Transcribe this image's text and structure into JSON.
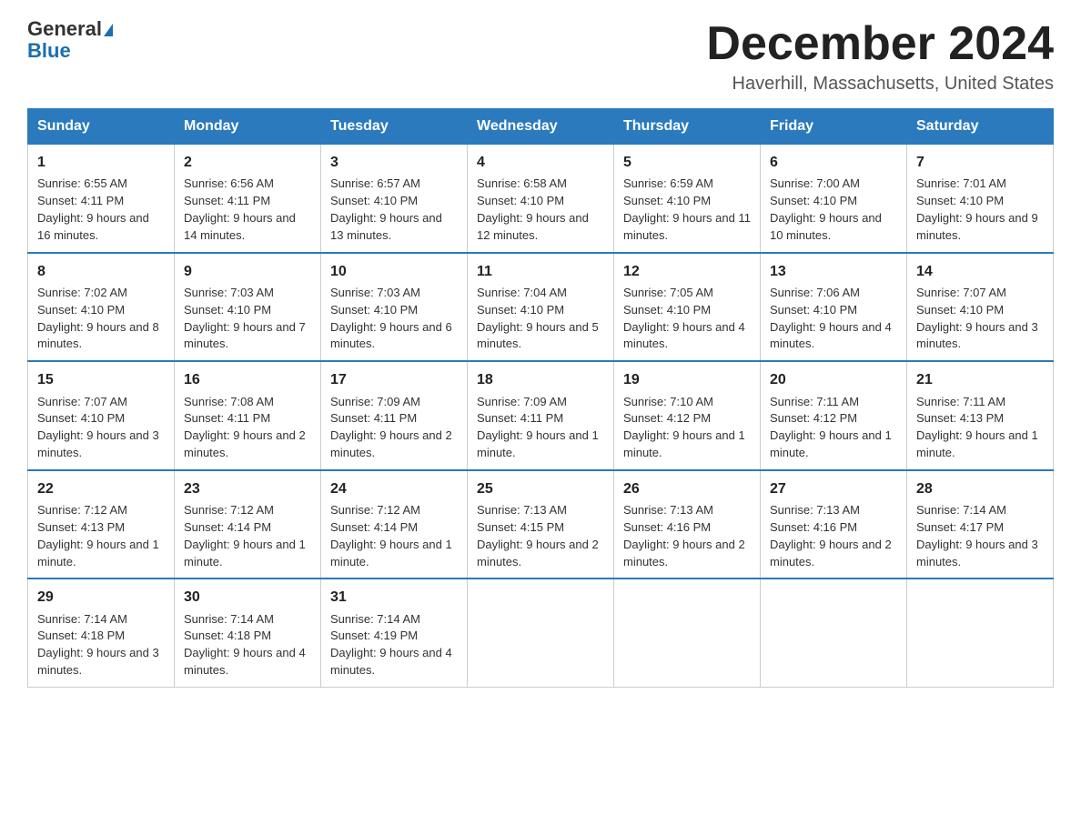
{
  "header": {
    "logo_general": "General",
    "logo_blue": "Blue",
    "month_title": "December 2024",
    "location": "Haverhill, Massachusetts, United States"
  },
  "days_of_week": [
    "Sunday",
    "Monday",
    "Tuesday",
    "Wednesday",
    "Thursday",
    "Friday",
    "Saturday"
  ],
  "weeks": [
    [
      {
        "day": "1",
        "sunrise": "6:55 AM",
        "sunset": "4:11 PM",
        "daylight": "9 hours and 16 minutes."
      },
      {
        "day": "2",
        "sunrise": "6:56 AM",
        "sunset": "4:11 PM",
        "daylight": "9 hours and 14 minutes."
      },
      {
        "day": "3",
        "sunrise": "6:57 AM",
        "sunset": "4:10 PM",
        "daylight": "9 hours and 13 minutes."
      },
      {
        "day": "4",
        "sunrise": "6:58 AM",
        "sunset": "4:10 PM",
        "daylight": "9 hours and 12 minutes."
      },
      {
        "day": "5",
        "sunrise": "6:59 AM",
        "sunset": "4:10 PM",
        "daylight": "9 hours and 11 minutes."
      },
      {
        "day": "6",
        "sunrise": "7:00 AM",
        "sunset": "4:10 PM",
        "daylight": "9 hours and 10 minutes."
      },
      {
        "day": "7",
        "sunrise": "7:01 AM",
        "sunset": "4:10 PM",
        "daylight": "9 hours and 9 minutes."
      }
    ],
    [
      {
        "day": "8",
        "sunrise": "7:02 AM",
        "sunset": "4:10 PM",
        "daylight": "9 hours and 8 minutes."
      },
      {
        "day": "9",
        "sunrise": "7:03 AM",
        "sunset": "4:10 PM",
        "daylight": "9 hours and 7 minutes."
      },
      {
        "day": "10",
        "sunrise": "7:03 AM",
        "sunset": "4:10 PM",
        "daylight": "9 hours and 6 minutes."
      },
      {
        "day": "11",
        "sunrise": "7:04 AM",
        "sunset": "4:10 PM",
        "daylight": "9 hours and 5 minutes."
      },
      {
        "day": "12",
        "sunrise": "7:05 AM",
        "sunset": "4:10 PM",
        "daylight": "9 hours and 4 minutes."
      },
      {
        "day": "13",
        "sunrise": "7:06 AM",
        "sunset": "4:10 PM",
        "daylight": "9 hours and 4 minutes."
      },
      {
        "day": "14",
        "sunrise": "7:07 AM",
        "sunset": "4:10 PM",
        "daylight": "9 hours and 3 minutes."
      }
    ],
    [
      {
        "day": "15",
        "sunrise": "7:07 AM",
        "sunset": "4:10 PM",
        "daylight": "9 hours and 3 minutes."
      },
      {
        "day": "16",
        "sunrise": "7:08 AM",
        "sunset": "4:11 PM",
        "daylight": "9 hours and 2 minutes."
      },
      {
        "day": "17",
        "sunrise": "7:09 AM",
        "sunset": "4:11 PM",
        "daylight": "9 hours and 2 minutes."
      },
      {
        "day": "18",
        "sunrise": "7:09 AM",
        "sunset": "4:11 PM",
        "daylight": "9 hours and 1 minute."
      },
      {
        "day": "19",
        "sunrise": "7:10 AM",
        "sunset": "4:12 PM",
        "daylight": "9 hours and 1 minute."
      },
      {
        "day": "20",
        "sunrise": "7:11 AM",
        "sunset": "4:12 PM",
        "daylight": "9 hours and 1 minute."
      },
      {
        "day": "21",
        "sunrise": "7:11 AM",
        "sunset": "4:13 PM",
        "daylight": "9 hours and 1 minute."
      }
    ],
    [
      {
        "day": "22",
        "sunrise": "7:12 AM",
        "sunset": "4:13 PM",
        "daylight": "9 hours and 1 minute."
      },
      {
        "day": "23",
        "sunrise": "7:12 AM",
        "sunset": "4:14 PM",
        "daylight": "9 hours and 1 minute."
      },
      {
        "day": "24",
        "sunrise": "7:12 AM",
        "sunset": "4:14 PM",
        "daylight": "9 hours and 1 minute."
      },
      {
        "day": "25",
        "sunrise": "7:13 AM",
        "sunset": "4:15 PM",
        "daylight": "9 hours and 2 minutes."
      },
      {
        "day": "26",
        "sunrise": "7:13 AM",
        "sunset": "4:16 PM",
        "daylight": "9 hours and 2 minutes."
      },
      {
        "day": "27",
        "sunrise": "7:13 AM",
        "sunset": "4:16 PM",
        "daylight": "9 hours and 2 minutes."
      },
      {
        "day": "28",
        "sunrise": "7:14 AM",
        "sunset": "4:17 PM",
        "daylight": "9 hours and 3 minutes."
      }
    ],
    [
      {
        "day": "29",
        "sunrise": "7:14 AM",
        "sunset": "4:18 PM",
        "daylight": "9 hours and 3 minutes."
      },
      {
        "day": "30",
        "sunrise": "7:14 AM",
        "sunset": "4:18 PM",
        "daylight": "9 hours and 4 minutes."
      },
      {
        "day": "31",
        "sunrise": "7:14 AM",
        "sunset": "4:19 PM",
        "daylight": "9 hours and 4 minutes."
      },
      null,
      null,
      null,
      null
    ]
  ],
  "labels": {
    "sunrise": "Sunrise:",
    "sunset": "Sunset:",
    "daylight": "Daylight:"
  }
}
